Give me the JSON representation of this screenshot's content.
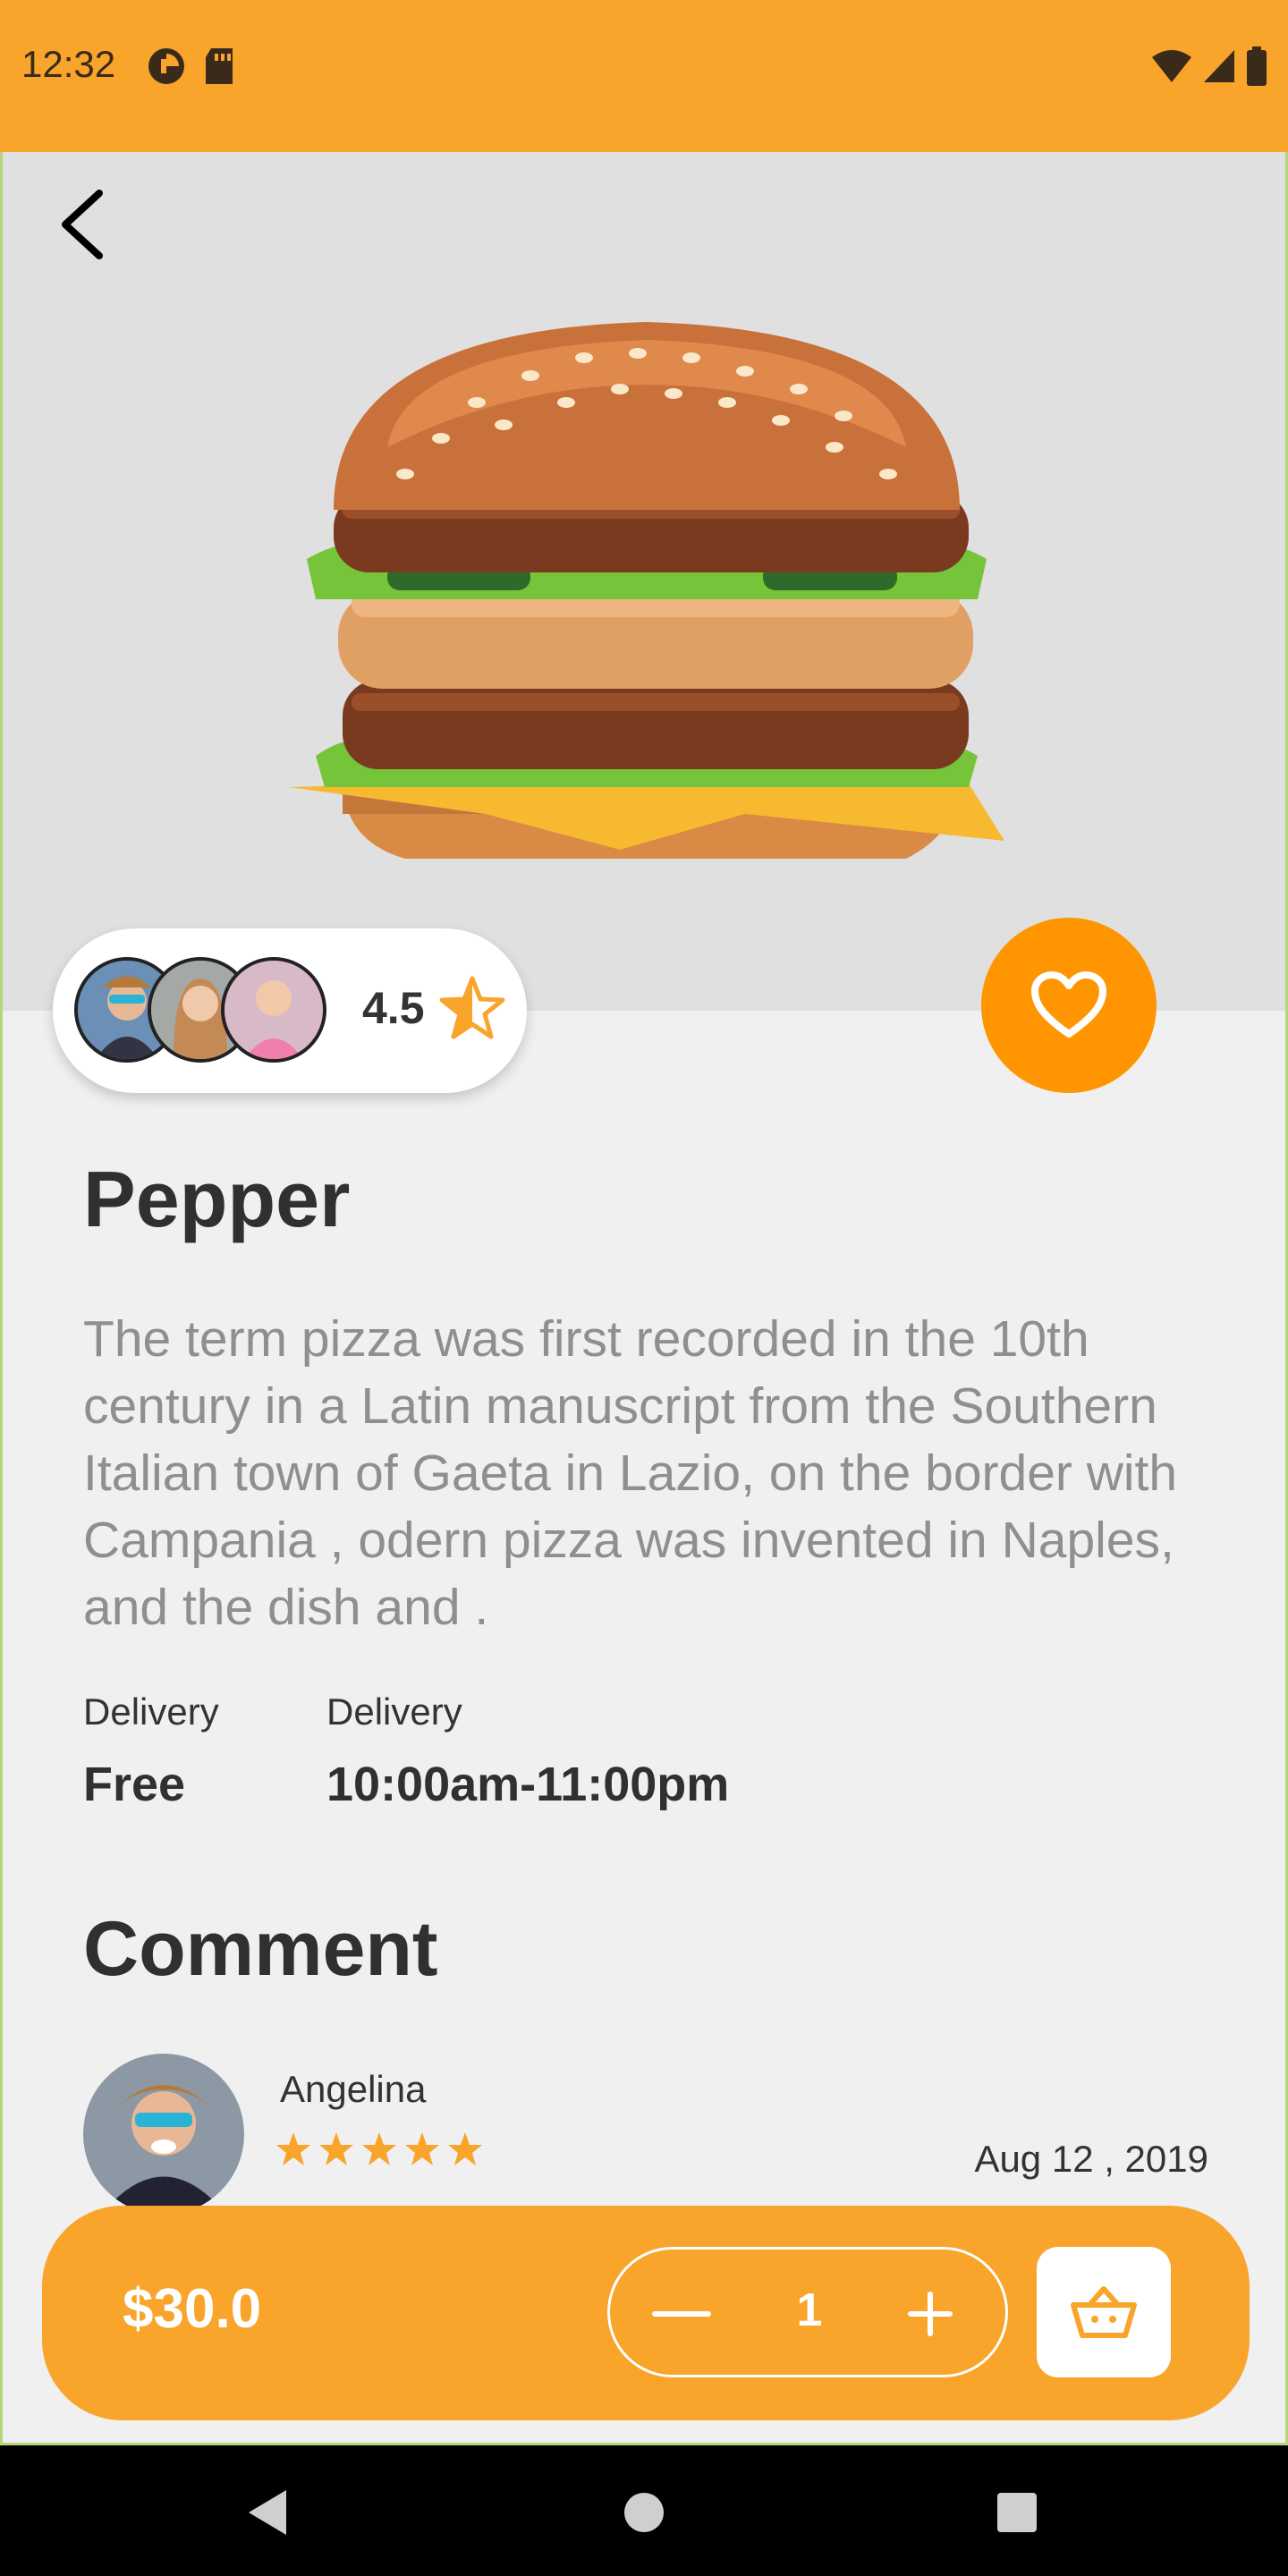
{
  "status_bar": {
    "time": "12:32",
    "left_icons": [
      "data-saver-icon",
      "sd-card-icon"
    ],
    "right_icons": [
      "wifi-icon",
      "signal-icon",
      "battery-icon"
    ]
  },
  "colors": {
    "accent": "#f9a42a",
    "favorite": "#ff9500",
    "text_dark": "#303030",
    "text_muted": "#8f8f8f"
  },
  "product": {
    "image_icon": "burger-image",
    "rating": "4.5",
    "name": "Pepper",
    "description": "The term pizza was first recorded in the 10th century in a Latin manuscript from the Southern Italian town of Gaeta in Lazio, on the border with Campania , odern pizza was invented in Naples, and the dish and .",
    "delivery_fee_label": "Delivery",
    "delivery_fee_value": "Free",
    "delivery_time_label": "Delivery",
    "delivery_time_value": "10:00am-11:00pm"
  },
  "comments": {
    "heading": "Comment",
    "items": [
      {
        "name": "Angelina",
        "stars": 5,
        "date": "Aug 12 , 2019"
      }
    ]
  },
  "cart": {
    "price": "$30.0",
    "quantity": "1"
  },
  "nav": [
    "back-triangle-icon",
    "home-circle-icon",
    "recents-square-icon"
  ]
}
